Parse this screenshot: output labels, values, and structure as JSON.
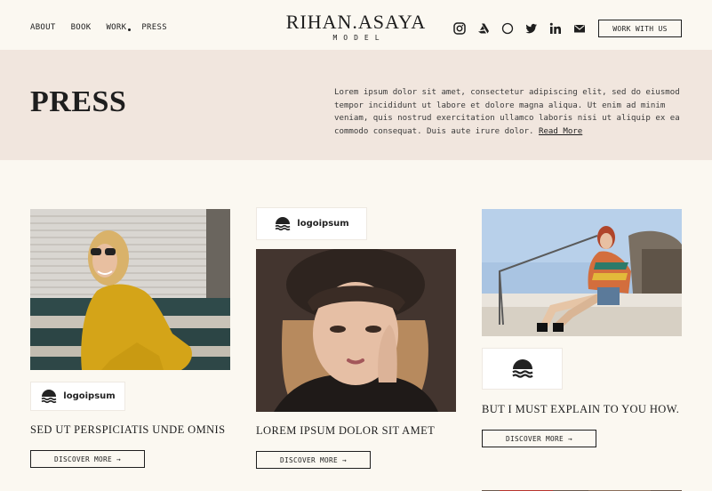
{
  "nav": {
    "items": [
      {
        "label": "ABOUT"
      },
      {
        "label": "BOOK"
      },
      {
        "label": "WORK"
      },
      {
        "label": "PRESS"
      }
    ]
  },
  "brand": {
    "name": "RIHAN.ASAYA",
    "subtitle": "MODEL"
  },
  "socials": [
    "instagram-icon",
    "artstation-icon",
    "circle-icon",
    "twitter-icon",
    "linkedin-icon",
    "mail-icon"
  ],
  "header": {
    "cta_label": "WORK WITH US"
  },
  "hero": {
    "title": "PRESS",
    "body": "Lorem ipsum dolor sit amet, consectetur adipiscing elit, sed do eiusmod tempor incididunt ut labore et dolore magna aliqua. Ut enim ad minim veniam, quis nostrud exercitation ullamco laboris nisi ut aliquip ex ea commodo consequat. Duis aute irure dolor.",
    "read_more": "Read More"
  },
  "cards": [
    {
      "logo_text": "logoipsum",
      "title": "SED UT PERSPICIATIS UNDE OMNIS",
      "button": "DISCOVER MORE"
    },
    {
      "logo_text": "logoipsum",
      "title": "LOREM IPSUM DOLOR SIT AMET",
      "button": "DISCOVER MORE"
    },
    {
      "logo_text": "",
      "title": "BUT I MUST EXPLAIN TO YOU HOW.",
      "button": "DISCOVER MORE"
    }
  ],
  "colors": {
    "background": "#fbf8f1",
    "hero_band": "#f1e6de",
    "ink": "#1e1e1e"
  }
}
